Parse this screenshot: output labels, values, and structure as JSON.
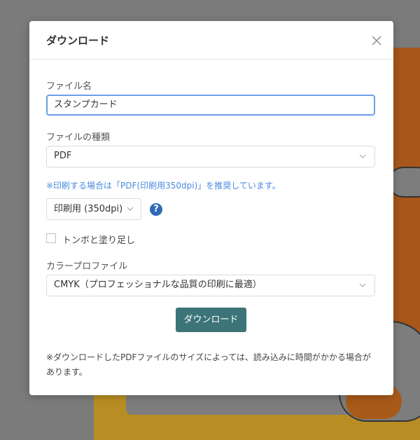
{
  "modal": {
    "title": "ダウンロード",
    "file_name_label": "ファイル名",
    "file_name_value": "スタンプカード",
    "file_type_label": "ファイルの種類",
    "file_type_value": "PDF",
    "print_note": "※印刷する場合は「PDF(印刷用350dpi)」を推奨しています。",
    "print_quality_value": "印刷用 (350dpi)",
    "help_symbol": "?",
    "trim_marks_label": "トンボと塗り足し",
    "trim_marks_checked": false,
    "color_profile_label": "カラープロファイル",
    "color_profile_value": "CMYK（プロフェッショナルな品質の印刷に最適）",
    "download_button": "ダウンロード",
    "footnote": "※ダウンロードしたPDFファイルのサイズによっては、読み込みに時間がかかる場合があります。"
  },
  "icons": {
    "close": "close-icon",
    "chevron": "chevron-down-icon",
    "help": "question-circle-icon"
  },
  "colors": {
    "accent_button": "#3c7478",
    "note_text": "#4a8be0",
    "focus_border": "#6d9ee8",
    "help_icon": "#2f6bb5"
  }
}
